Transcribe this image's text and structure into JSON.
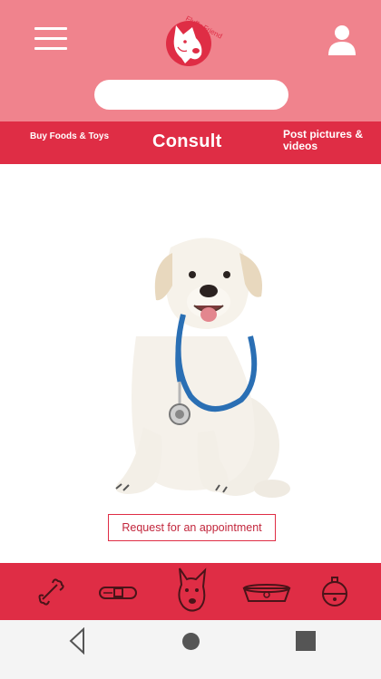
{
  "header": {
    "logo_text": "Fluffy Friend",
    "search": {
      "value": "",
      "placeholder": ""
    }
  },
  "tabs": [
    {
      "label": "Buy Foods & Toys",
      "active": false
    },
    {
      "label": "Consult",
      "active": true
    },
    {
      "label": "Post pictures & videos",
      "active": false
    }
  ],
  "main": {
    "image_subject": "puppy-with-stethoscope",
    "appointment_button_label": "Request for an appointment"
  },
  "bottom_bar": {
    "icons": [
      "bone-icon",
      "collar-icon",
      "dog-face-icon",
      "food-bowl-icon",
      "bell-icon"
    ]
  },
  "colors": {
    "header_bg": "#f0838d",
    "accent_red": "#df2d45",
    "icon_dark": "#4a1419"
  }
}
